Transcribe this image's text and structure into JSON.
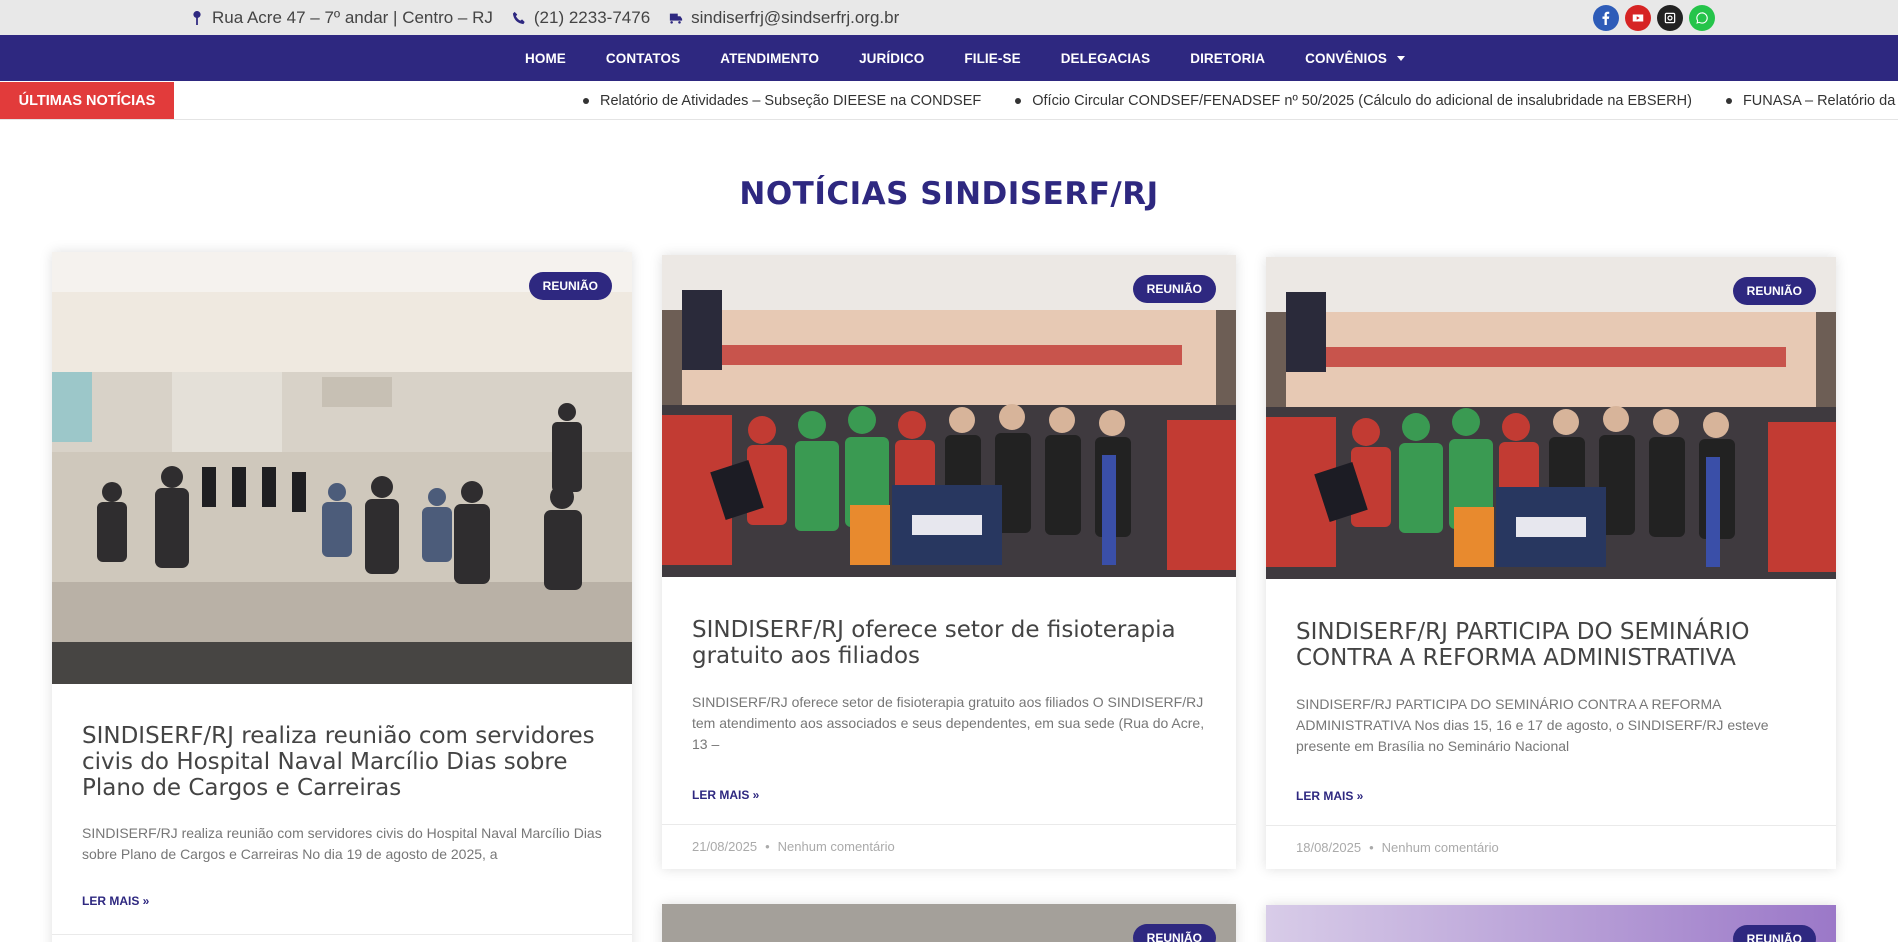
{
  "topbar": {
    "address": "Rua Acre 47 – 7º andar | Centro – RJ",
    "phone": "(21) 2233-7476",
    "email": "sindiserfrj@sindserfrj.org.br",
    "social_icons": [
      "facebook-icon",
      "youtube-icon",
      "instagram-icon",
      "whatsapp-icon"
    ],
    "social_colors": [
      "#2e5cb8",
      "#d62424",
      "#222222",
      "#25c44a"
    ]
  },
  "nav": {
    "items": [
      "HOME",
      "CONTATOS",
      "ATENDIMENTO",
      "JURÍDICO",
      "FILIE-SE",
      "DELEGACIAS",
      "DIRETORIA",
      "CONVÊNIOS"
    ]
  },
  "ticker": {
    "label": "ÚLTIMAS NOTÍCIAS",
    "items": [
      "Relatório de Atividades – Subseção DIEESE na CONDSEF",
      "Ofício Circular CONDSEF/FENADSEF nº 50/2025 (Cálculo do adicional de insalubridade na EBSERH)",
      "FUNASA – Relatório da 1ª Reunião"
    ]
  },
  "section": {
    "title": "NOTÍCIAS SINDISERF/RJ"
  },
  "cards": [
    {
      "badge": "REUNIÃO",
      "title": "SINDISERF/RJ realiza reunião com servidores civis do Hospital Naval Marcílio Dias sobre Plano de Cargos e Carreiras",
      "excerpt": "SINDISERF/RJ realiza reunião com servidores civis do Hospital Naval Marcílio Dias sobre Plano de Cargos e Carreiras No dia 19 de agosto de 2025, a",
      "more": "LER MAIS »"
    },
    {
      "badge": "REUNIÃO",
      "title": "SINDISERF/RJ oferece setor de fisioterapia gratuito aos filiados",
      "excerpt": "SINDISERF/RJ oferece setor de fisioterapia gratuito aos filiados O SINDISERF/RJ tem atendimento aos associados e seus dependentes, em sua sede (Rua do Acre, 13 –",
      "more": "LER MAIS »",
      "date": "21/08/2025",
      "comments": "Nenhum comentário"
    },
    {
      "badge": "REUNIÃO",
      "title": "SINDISERF/RJ PARTICIPA DO SEMINÁRIO CONTRA A REFORMA ADMINISTRATIVA",
      "excerpt": "SINDISERF/RJ PARTICIPA DO SEMINÁRIO CONTRA A REFORMA ADMINISTRATIVA Nos dias 15, 16 e 17 de agosto, o SINDISERF/RJ esteve presente em Brasília no Seminário Nacional",
      "more": "LER MAIS »",
      "date": "18/08/2025",
      "comments": "Nenhum comentário"
    },
    {
      "badge": "REUNIÃO"
    },
    {
      "badge": "REUNIÃO"
    }
  ],
  "colors": {
    "brand": "#2e2880",
    "ticker_label": "#e23b3b"
  }
}
